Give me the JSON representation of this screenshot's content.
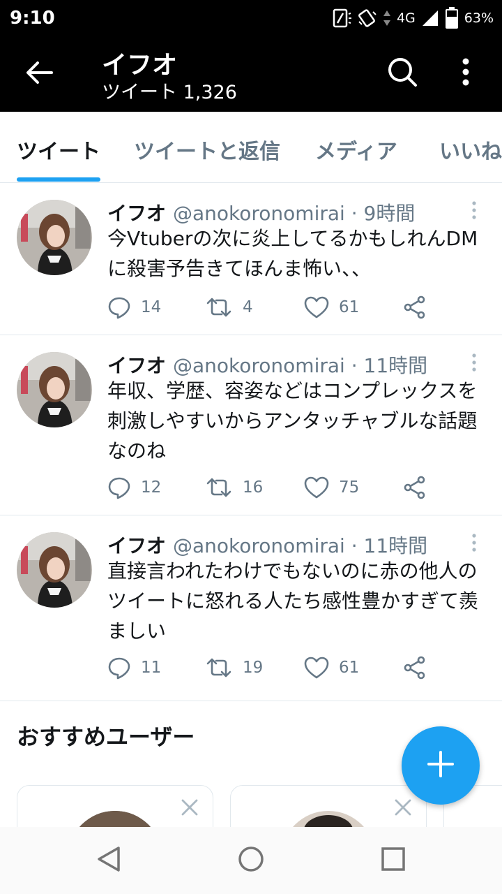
{
  "status": {
    "time": "9:10",
    "network": "4G",
    "battery": "63%"
  },
  "header": {
    "title": "イフオ",
    "subtitle": "ツイート 1,326"
  },
  "tabs": [
    {
      "label": "ツイート",
      "active": true
    },
    {
      "label": "ツイートと返信",
      "active": false
    },
    {
      "label": "メディア",
      "active": false
    },
    {
      "label": "いいね",
      "active": false
    }
  ],
  "tweets": [
    {
      "name": "イフオ",
      "handle": "@anokoronomirai",
      "time": "· 9時間",
      "text": "今Vtuberの次に炎上してるかもしれんDMに殺害予告きてほんま怖い、、",
      "replies": "14",
      "retweets": "4",
      "likes": "61"
    },
    {
      "name": "イフオ",
      "handle": "@anokoronomirai",
      "time": "· 11時間",
      "text": "年収、学歴、容姿などはコンプレックスを刺激しやすいからアンタッチャブルな話題なのね",
      "replies": "12",
      "retweets": "16",
      "likes": "75"
    },
    {
      "name": "イフオ",
      "handle": "@anokoronomirai",
      "time": "· 11時間",
      "text": "直接言われたわけでもないのに赤の他人のツイートに怒れる人たち感性豊かすぎて羨ましい",
      "replies": "11",
      "retweets": "19",
      "likes": "61"
    }
  ],
  "recommended": {
    "title": "おすすめユーザー"
  },
  "colors": {
    "accent": "#1da1f2",
    "secondary_text": "#657786",
    "divider": "#e1e8ed"
  },
  "icons": [
    "back-arrow-icon",
    "search-icon",
    "more-vertical-icon",
    "reply-icon",
    "retweet-icon",
    "like-icon",
    "share-icon",
    "plus-icon",
    "close-icon"
  ]
}
